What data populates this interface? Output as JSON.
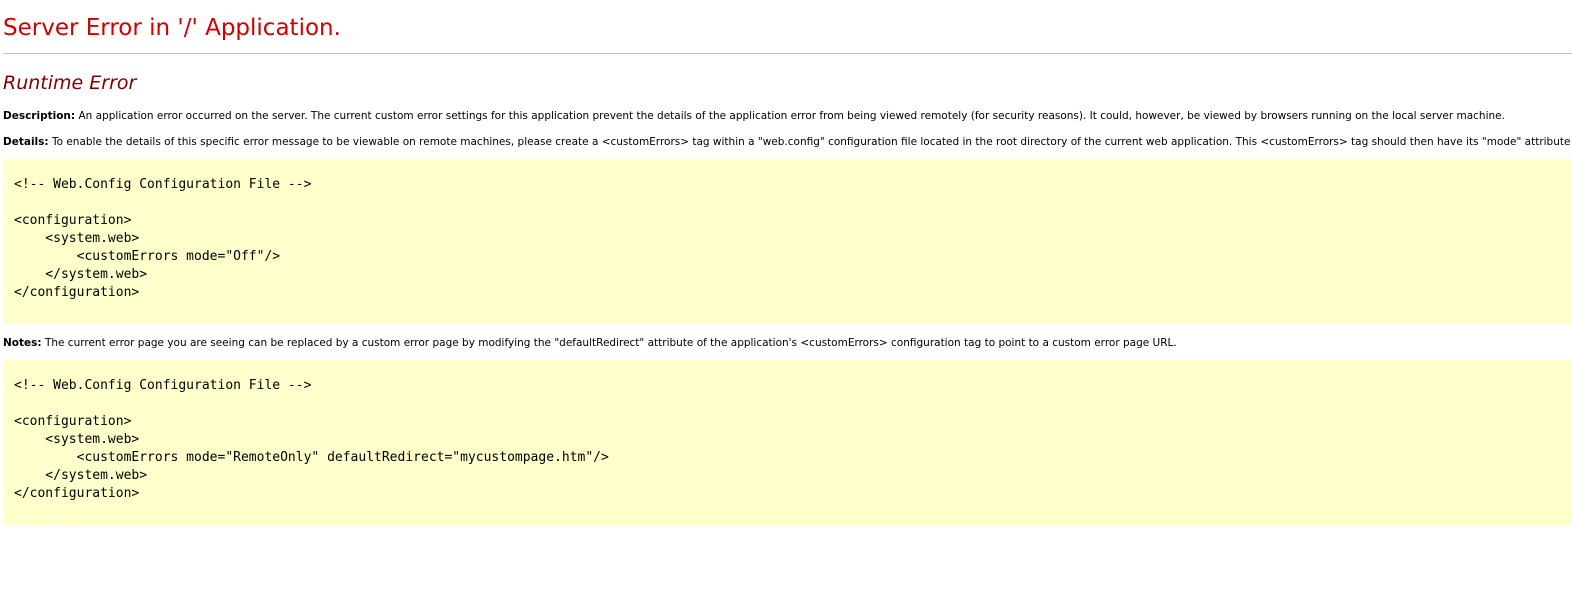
{
  "header": {
    "title": "Server Error in '/' Application.",
    "subtitle": "Runtime Error"
  },
  "description": {
    "label": "Description:",
    "text": "An application error occurred on the server. The current custom error settings for this application prevent the details of the application error from being viewed remotely (for security reasons). It could, however, be viewed by browsers running on the local server machine."
  },
  "details": {
    "label": "Details:",
    "text": "To enable the details of this specific error message to be viewable on remote machines, please create a <customErrors> tag within a \"web.config\" configuration file located in the root directory of the current web application. This <customErrors> tag should then have its \"mode\" attribute set to \"Off\"."
  },
  "code_block_1": "<!-- Web.Config Configuration File -->\n\n<configuration>\n    <system.web>\n        <customErrors mode=\"Off\"/>\n    </system.web>\n</configuration>",
  "notes": {
    "label": "Notes:",
    "text": "The current error page you are seeing can be replaced by a custom error page by modifying the \"defaultRedirect\" attribute of the application's <customErrors> configuration tag to point to a custom error page URL."
  },
  "code_block_2": "<!-- Web.Config Configuration File -->\n\n<configuration>\n    <system.web>\n        <customErrors mode=\"RemoteOnly\" defaultRedirect=\"mycustompage.htm\"/>\n    </system.web>\n</configuration>",
  "colors": {
    "title": "#d00000",
    "subtitle": "#800000",
    "code_background": "#ffffcc",
    "rule": "#c0c0c0"
  }
}
